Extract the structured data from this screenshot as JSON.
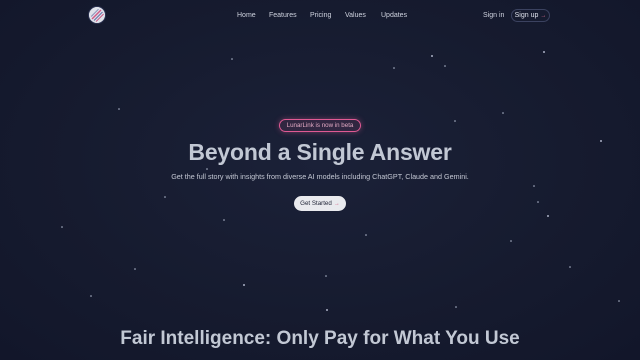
{
  "nav": {
    "links": [
      "Home",
      "Features",
      "Pricing",
      "Values",
      "Updates"
    ],
    "signin_label": "Sign in",
    "signup_label": "Sign up",
    "signup_icon": "arrow-right-icon",
    "logo_icon": "lunarlink-logo"
  },
  "hero": {
    "badge": "LunarLink is now in beta",
    "title": "Beyond a Single Answer",
    "subtitle": "Get the full story with insights from diverse AI models including ChatGPT, Claude and Gemini.",
    "cta_label": "Get Started",
    "cta_icon": "arrow-right-icon"
  },
  "pricing": {
    "title": "Fair Intelligence: Only Pay for What You Use"
  },
  "colors": {
    "background": "#151a2e",
    "accent": "#e05a94",
    "text": "#c2c8d4"
  }
}
